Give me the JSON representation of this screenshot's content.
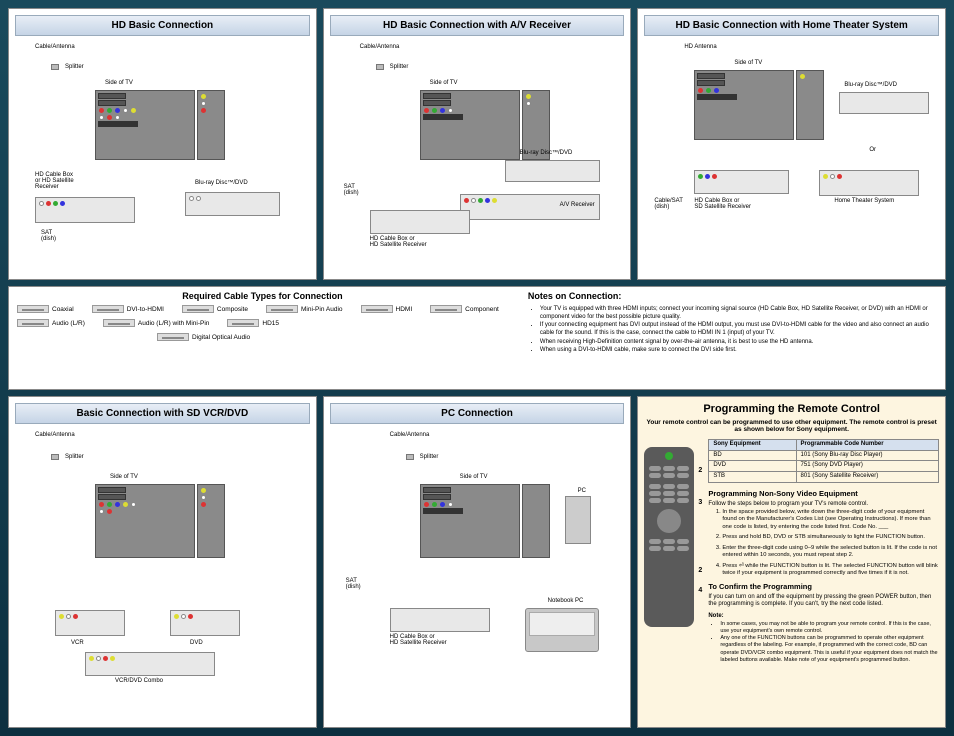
{
  "panels": {
    "hd_basic": "HD Basic Connection",
    "hd_av": "HD Basic Connection with A/V Receiver",
    "hd_ht": "HD Basic Connection with Home Theater System",
    "sd_vcr": "Basic Connection with SD VCR/DVD",
    "pc": "PC Connection"
  },
  "labels": {
    "cable_antenna": "Cable/Antenna",
    "hd_antenna": "HD Antenna",
    "splitter": "Splitter",
    "side_tv": "Side of TV",
    "hd_box": "HD Cable Box\nor HD Satellite\nReceiver",
    "hd_box2": "HD Cable Box or\nHD Satellite Receiver",
    "sd_box": "HD Cable Box or\nSD Satellite Receiver",
    "bluray": "Blu-ray Disc™/DVD",
    "sat": "SAT\n(dish)",
    "cable_sat": "Cable/SAT\n(dish)",
    "av_receiver": "A/V Receiver",
    "hts": "Home Theater System",
    "or": "Or",
    "vcr": "VCR",
    "dvd": "DVD",
    "vcr_combo": "VCR/DVD Combo",
    "pc": "PC",
    "notebook": "Notebook PC"
  },
  "cables": {
    "title": "Required Cable Types for Connection",
    "list": [
      "Coaxial",
      "HDMI",
      "HD15",
      "DVI-to-HDMI",
      "Component",
      "Composite",
      "Audio (L/R)",
      "Mini-Pin Audio",
      "Audio (L/R) with Mini-Pin",
      "Digital Optical Audio"
    ]
  },
  "notes": {
    "title": "Notes on Connection:",
    "items": [
      "Your TV is equipped with three HDMI inputs; connect your incoming signal source (HD Cable Box, HD Satellite Receiver, or DVD) with an HDMI or component video for the best possible picture quality.",
      "If your connecting equipment has DVI output instead of the HDMI output, you must use DVI-to-HDMI cable for the video and also connect an audio cable for the sound. If this is the case, connect the cable to HDMI IN 1 (input) of your TV.",
      "When receiving High-Definition content signal by over-the-air antenna, it is best to use the HD antenna.",
      "When using a DVI-to-HDMI cable, make sure to connect the DVI side first."
    ]
  },
  "programming": {
    "title": "Programming the Remote Control",
    "subtitle": "Your remote control can be programmed to use other equipment. The remote control is preset as shown below for Sony equipment.",
    "table_headers": [
      "Sony Equipment",
      "Programmable Code Number"
    ],
    "table_rows": [
      [
        "BD",
        "101 (Sony Blu-ray Disc Player)"
      ],
      [
        "DVD",
        "751 (Sony DVD Player)"
      ],
      [
        "STB",
        "801 (Sony Satellite Receiver)"
      ]
    ],
    "h1": "Programming Non-Sony Video Equipment",
    "h1_sub": "Follow the steps below to program your TV's remote control.",
    "steps": [
      "In the space provided below, write down the three-digit code of your equipment found on the Manufacturer's Codes List (see Operating Instructions). If more than one code is listed, try entering the code listed first. Code No. ___",
      "Press and hold BD, DVD or STB simultaneously to light the FUNCTION button.",
      "Enter the three-digit code using 0–9 while the selected button is lit. If the code is not entered within 10 seconds, you must repeat step 2.",
      "Press ⏎ while the FUNCTION button is lit. The selected FUNCTION button will blink twice if your equipment is programmed correctly and five times if it is not."
    ],
    "h2": "To Confirm the Programming",
    "h2_text": "If you can turn on and off the equipment by pressing the green POWER button, then the programming is complete. If you can't, try the next code listed.",
    "note_h": "Note:",
    "notes": [
      "In some cases, you may not be able to program your remote control. If this is the case, use your equipment's own remote control.",
      "Any one of the FUNCTION buttons can be programmed to operate other equipment regardless of the labeling. For example, if programmed with the correct code, BD can operate DVD/VCR combo equipment. This is useful if your equipment does not match the labeled buttons available. Make note of your equipment's programmed button."
    ],
    "callouts": [
      "2",
      "3",
      "2",
      "4"
    ]
  }
}
